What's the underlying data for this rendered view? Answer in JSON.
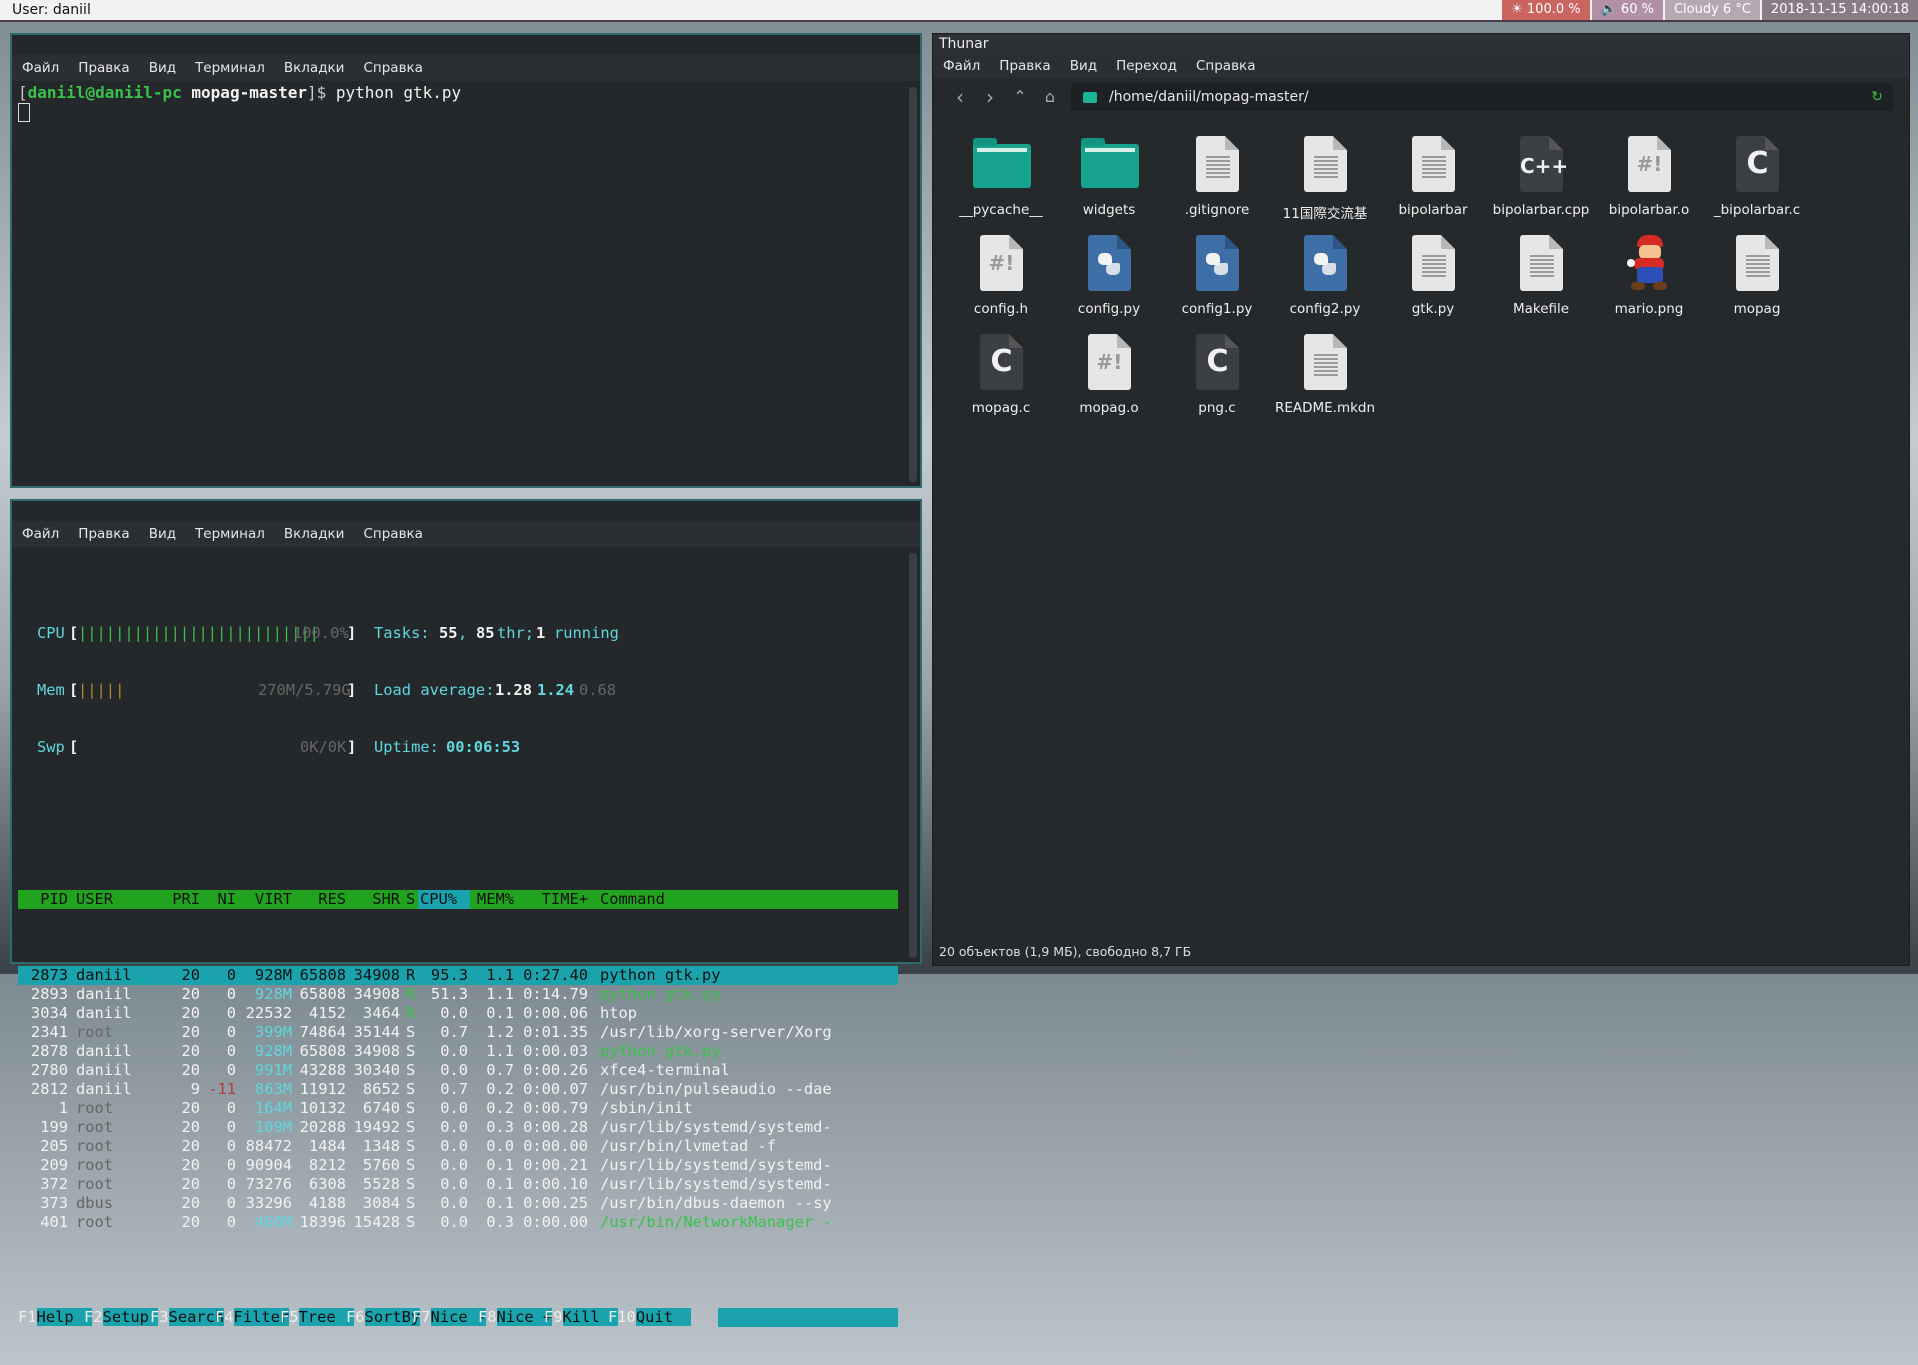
{
  "panel": {
    "user": "User: daniil",
    "brightness": "☀ 100.0 %",
    "volume": "🔈 60 %",
    "weather": "Cloudy 6 °C",
    "clock": "2018-11-15 14:00:18"
  },
  "terminal_menu": [
    "Файл",
    "Правка",
    "Вид",
    "Терминал",
    "Вкладки",
    "Справка"
  ],
  "terminal1": {
    "prompt_user": "daniil@daniil-pc",
    "prompt_dir": "mopag-master",
    "prompt_open": "[",
    "prompt_close": "]$",
    "command": "python gtk.py"
  },
  "htop": {
    "cpu_label": "CPU",
    "cpu_bar": "||||||||||||||||||||||||||",
    "cpu_value": "100.0%",
    "mem_label": "Mem",
    "mem_bar": "|||||",
    "mem_value": "270M/5.79G",
    "swp_label": "Swp",
    "swp_value": "0K/0K",
    "tasks_label": "Tasks:",
    "tasks_count": "55",
    "tasks_thr": "85",
    "tasks_thr_label": "thr;",
    "tasks_running": "1",
    "tasks_running_label": "running",
    "load_label": "Load average:",
    "load1": "1.28",
    "load5": "1.24",
    "load15": "0.68",
    "uptime_label": "Uptime:",
    "uptime": "00:06:53",
    "columns": [
      "PID",
      "USER",
      "PRI",
      "NI",
      "VIRT",
      "RES",
      "SHR",
      "S",
      "CPU%",
      "MEM%",
      "TIME+",
      "Command"
    ],
    "rows": [
      [
        "2873",
        "daniil",
        "20",
        "0",
        "928M",
        "65808",
        "34908",
        "R",
        "95.3",
        "1.1",
        "0:27.40",
        "python gtk.py"
      ],
      [
        "2893",
        "daniil",
        "20",
        "0",
        "928M",
        "65808",
        "34908",
        "R",
        "51.3",
        "1.1",
        "0:14.79",
        "python gtk.py"
      ],
      [
        "3034",
        "daniil",
        "20",
        "0",
        "22532",
        "4152",
        "3464",
        "R",
        "0.0",
        "0.1",
        "0:00.06",
        "htop"
      ],
      [
        "2341",
        "root",
        "20",
        "0",
        "399M",
        "74864",
        "35144",
        "S",
        "0.7",
        "1.2",
        "0:01.35",
        "/usr/lib/xorg-server/Xorg"
      ],
      [
        "2878",
        "daniil",
        "20",
        "0",
        "928M",
        "65808",
        "34908",
        "S",
        "0.0",
        "1.1",
        "0:00.03",
        "python gtk.py"
      ],
      [
        "2780",
        "daniil",
        "20",
        "0",
        "991M",
        "43288",
        "30340",
        "S",
        "0.0",
        "0.7",
        "0:00.26",
        "xfce4-terminal"
      ],
      [
        "2812",
        "daniil",
        "9",
        "-11",
        "863M",
        "11912",
        "8652",
        "S",
        "0.7",
        "0.2",
        "0:00.07",
        "/usr/bin/pulseaudio --dae"
      ],
      [
        "1",
        "root",
        "20",
        "0",
        "164M",
        "10132",
        "6740",
        "S",
        "0.0",
        "0.2",
        "0:00.79",
        "/sbin/init"
      ],
      [
        "199",
        "root",
        "20",
        "0",
        "109M",
        "20288",
        "19492",
        "S",
        "0.0",
        "0.3",
        "0:00.28",
        "/usr/lib/systemd/systemd-"
      ],
      [
        "205",
        "root",
        "20",
        "0",
        "88472",
        "1484",
        "1348",
        "S",
        "0.0",
        "0.0",
        "0:00.00",
        "/usr/bin/lvmetad -f"
      ],
      [
        "209",
        "root",
        "20",
        "0",
        "90904",
        "8212",
        "5760",
        "S",
        "0.0",
        "0.1",
        "0:00.21",
        "/usr/lib/systemd/systemd-"
      ],
      [
        "372",
        "root",
        "20",
        "0",
        "73276",
        "6308",
        "5528",
        "S",
        "0.0",
        "0.1",
        "0:00.10",
        "/usr/lib/systemd/systemd-"
      ],
      [
        "373",
        "dbus",
        "20",
        "0",
        "33296",
        "4188",
        "3084",
        "S",
        "0.0",
        "0.1",
        "0:00.25",
        "/usr/bin/dbus-daemon --sy"
      ],
      [
        "401",
        "root",
        "20",
        "0",
        "460M",
        "18396",
        "15428",
        "S",
        "0.0",
        "0.3",
        "0:00.00",
        "/usr/bin/NetworkManager -"
      ]
    ],
    "fkeys": [
      {
        "key": "F1",
        "label": "Help  "
      },
      {
        "key": "F2",
        "label": "Setup "
      },
      {
        "key": "F3",
        "label": "Search"
      },
      {
        "key": "F4",
        "label": "Filter"
      },
      {
        "key": "F5",
        "label": "Tree  "
      },
      {
        "key": "F6",
        "label": "SortBy"
      },
      {
        "key": "F7",
        "label": "Nice -"
      },
      {
        "key": "F8",
        "label": "Nice +"
      },
      {
        "key": "F9",
        "label": "Kill  "
      },
      {
        "key": "F10",
        "label": "Quit  "
      }
    ]
  },
  "thunar": {
    "title": "Thunar",
    "menu": [
      "Файл",
      "Правка",
      "Вид",
      "Переход",
      "Справка"
    ],
    "path": "/home/daniil/mopag-master/",
    "files": [
      {
        "name": "__pycache__",
        "icon": "folder-icon",
        "kind": "folder"
      },
      {
        "name": "widgets",
        "icon": "folder-icon",
        "kind": "folder"
      },
      {
        "name": ".gitignore",
        "icon": "text-file-icon",
        "kind": "text"
      },
      {
        "name": "11国際交流基",
        "icon": "text-file-icon",
        "kind": "text"
      },
      {
        "name": "bipolarbar",
        "icon": "text-file-icon",
        "kind": "text"
      },
      {
        "name": "bipolarbar.cpp",
        "icon": "cpp-file-icon",
        "kind": "cpp"
      },
      {
        "name": "bipolarbar.o",
        "icon": "binary-file-icon",
        "kind": "bin"
      },
      {
        "name": "_bipolarbar.c",
        "icon": "c-file-icon",
        "kind": "c"
      },
      {
        "name": "config.h",
        "icon": "binary-file-icon",
        "kind": "bin"
      },
      {
        "name": "config.py",
        "icon": "python-file-icon",
        "kind": "py"
      },
      {
        "name": "config1.py",
        "icon": "python-file-icon",
        "kind": "py"
      },
      {
        "name": "config2.py",
        "icon": "python-file-icon",
        "kind": "py"
      },
      {
        "name": "gtk.py",
        "icon": "text-file-icon",
        "kind": "text"
      },
      {
        "name": "Makefile",
        "icon": "text-file-icon",
        "kind": "text"
      },
      {
        "name": "mario.png",
        "icon": "mario-image-icon",
        "kind": "mario"
      },
      {
        "name": "mopag",
        "icon": "text-file-icon",
        "kind": "text"
      },
      {
        "name": "mopag.c",
        "icon": "c-file-icon",
        "kind": "c"
      },
      {
        "name": "mopag.o",
        "icon": "binary-file-icon",
        "kind": "bin"
      },
      {
        "name": "png.c",
        "icon": "c-file-icon",
        "kind": "c"
      },
      {
        "name": "README.mkdn",
        "icon": "text-file-icon",
        "kind": "text"
      }
    ],
    "status": "20 объектов (1,9 МБ), свободно 8,7 ГБ"
  }
}
